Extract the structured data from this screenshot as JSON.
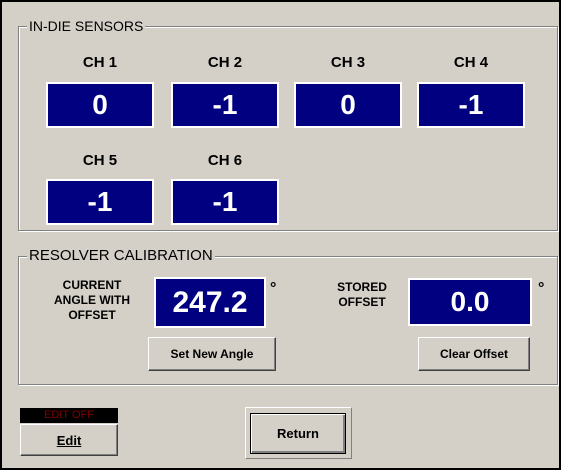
{
  "sensors": {
    "title": "IN-DIE SENSORS",
    "channels": [
      {
        "label": "CH 1",
        "value": "0"
      },
      {
        "label": "CH 2",
        "value": "-1"
      },
      {
        "label": "CH 3",
        "value": "0"
      },
      {
        "label": "CH 4",
        "value": "-1"
      },
      {
        "label": "CH 5",
        "value": "-1"
      },
      {
        "label": "CH 6",
        "value": "-1"
      }
    ]
  },
  "resolver": {
    "title": "RESOLVER CALIBRATION",
    "current_label_line1": "CURRENT",
    "current_label_line2": "ANGLE WITH",
    "current_label_line3": "OFFSET",
    "current_value": "247.2",
    "stored_label_line1": "STORED",
    "stored_label_line2": "OFFSET",
    "stored_value": "0.0",
    "degree_symbol": "°",
    "set_button": "Set New Angle",
    "clear_button": "Clear Offset"
  },
  "footer": {
    "edit_status": "EDIT OFF",
    "edit_button": "Edit",
    "return_button": "Return"
  },
  "colors": {
    "readout_bg": "#000080",
    "readout_text": "#ffffff",
    "panel_bg": "#d4d0c8",
    "edit_status_text": "#800000"
  }
}
